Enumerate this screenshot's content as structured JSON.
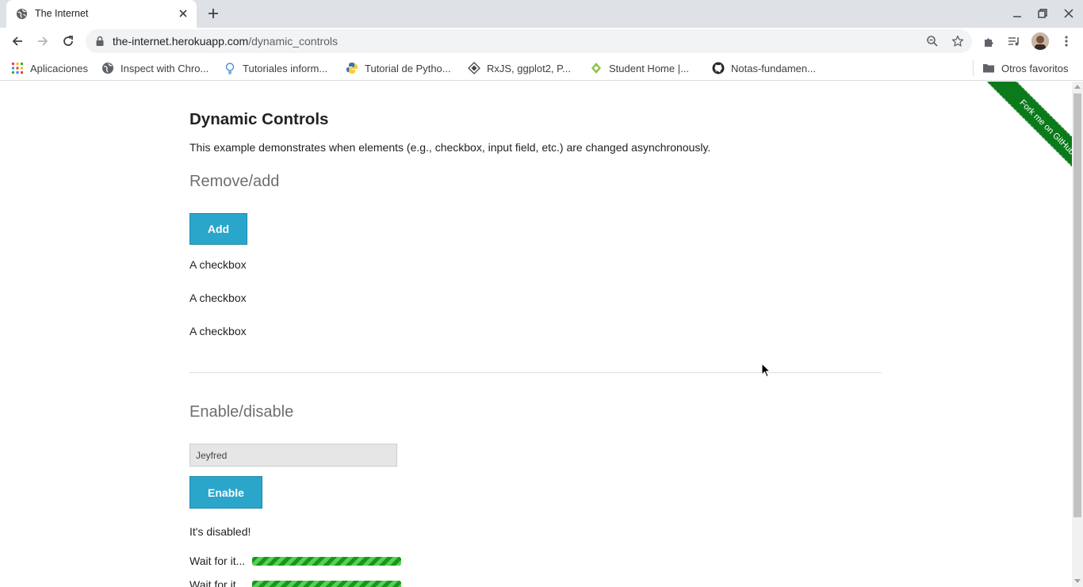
{
  "browser": {
    "tab": {
      "title": "The Internet"
    },
    "address": {
      "host": "the-internet.herokuapp.com",
      "path": "/dynamic_controls"
    },
    "bookmarks": [
      {
        "label": "Aplicaciones",
        "icon": "apps-grid-icon"
      },
      {
        "label": "Inspect with Chro...",
        "icon": "globe-icon"
      },
      {
        "label": "Tutoriales inform...",
        "icon": "bulb-icon"
      },
      {
        "label": "Tutorial de Pytho...",
        "icon": "python-icon"
      },
      {
        "label": "RxJS, ggplot2, P...",
        "icon": "diamond-icon"
      },
      {
        "label": "Student Home |...",
        "icon": "leaf-icon"
      },
      {
        "label": "Notas-fundamen...",
        "icon": "github-icon"
      }
    ],
    "other_bookmarks": "Otros favoritos"
  },
  "page": {
    "ribbon": "Fork me on GitHub",
    "title": "Dynamic Controls",
    "description": "This example demonstrates when elements (e.g., checkbox, input field, etc.) are changed asynchronously.",
    "remove_add": {
      "heading": "Remove/add",
      "button": "Add",
      "checkbox_labels": [
        "A checkbox",
        "A checkbox",
        "A checkbox"
      ]
    },
    "enable_disable": {
      "heading": "Enable/disable",
      "input_value": "Jeyfred",
      "button": "Enable",
      "message": "It's disabled!",
      "loading": [
        {
          "label": "Wait for it...",
          "progress": 1.0
        },
        {
          "label": "Wait for it...",
          "progress": 1.0
        }
      ]
    }
  },
  "colors": {
    "button": "#2ba6cb",
    "progress": "#22a22a",
    "ribbon": "#0a7a1a",
    "section_heading": "#6f6f6f"
  }
}
